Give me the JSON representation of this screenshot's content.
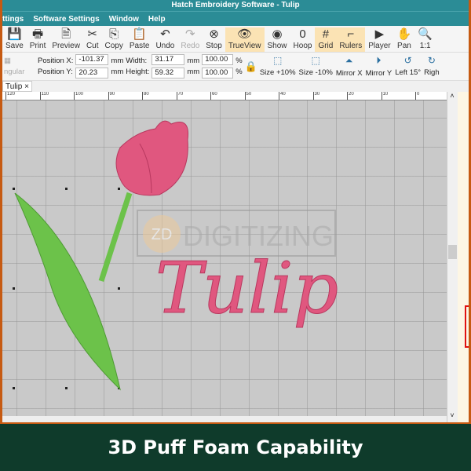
{
  "window": {
    "title": "Hatch Embroidery Software - Tulip"
  },
  "menu": [
    "ttings",
    "Software Settings",
    "Window",
    "Help"
  ],
  "toolbar": [
    {
      "label": "Save",
      "icon": "save-icon",
      "glyph": "💾"
    },
    {
      "label": "Print",
      "icon": "print-icon",
      "glyph": "🖶"
    },
    {
      "label": "Preview",
      "icon": "preview-icon",
      "glyph": "🗎"
    },
    {
      "label": "Cut",
      "icon": "cut-icon",
      "glyph": "✂"
    },
    {
      "label": "Copy",
      "icon": "copy-icon",
      "glyph": "⎘"
    },
    {
      "label": "Paste",
      "icon": "paste-icon",
      "glyph": "📋"
    },
    {
      "label": "Undo",
      "icon": "undo-icon",
      "glyph": "↶"
    },
    {
      "label": "Redo",
      "icon": "redo-icon",
      "glyph": "↷",
      "disabled": true
    },
    {
      "label": "Stop",
      "icon": "stop-icon",
      "glyph": "⊗"
    },
    {
      "label": "TrueView",
      "icon": "eye-icon",
      "glyph": "👁",
      "active": true
    },
    {
      "label": "Show",
      "icon": "show-icon",
      "glyph": "◉"
    },
    {
      "label": "Hoop",
      "icon": "hoop-icon",
      "glyph": "0"
    },
    {
      "label": "Grid",
      "icon": "grid-icon",
      "glyph": "#",
      "active": true
    },
    {
      "label": "Rulers",
      "icon": "rulers-icon",
      "glyph": "⌐",
      "active": true
    },
    {
      "label": "Player",
      "icon": "player-icon",
      "glyph": "▶"
    },
    {
      "label": "Pan",
      "icon": "hand-icon",
      "glyph": "✋"
    },
    {
      "label": "1:1",
      "icon": "zoom-icon",
      "glyph": "🔍"
    }
  ],
  "props": {
    "mode": "ngular",
    "pos_x_label": "Position X:",
    "pos_y_label": "Position Y:",
    "pos_x": "-101.37",
    "pos_y": "20.23",
    "width_label": "Width:",
    "height_label": "Height:",
    "width": "31.17",
    "height": "59.32",
    "unit": "mm",
    "pct_w": "100.00",
    "pct_h": "100.00",
    "pct": "%"
  },
  "transforms": [
    {
      "label": "Size +10%",
      "glyph": "⬚"
    },
    {
      "label": "Size -10%",
      "glyph": "⬚"
    },
    {
      "label": "Mirror X",
      "glyph": "⏶"
    },
    {
      "label": "Mirror Y",
      "glyph": "⏵"
    },
    {
      "label": "Left 15°",
      "glyph": "↺"
    },
    {
      "label": "Righ",
      "glyph": "↻"
    }
  ],
  "tab": {
    "label": "Tulip",
    "close": "×"
  },
  "ruler": [
    "120",
    "110",
    "100",
    "90",
    "80",
    "70",
    "60",
    "50",
    "40",
    "30",
    "20",
    "10",
    "0"
  ],
  "design": {
    "text": "Tulip",
    "color_pink": "#e0577f",
    "color_green": "#6cc24a"
  },
  "watermark": {
    "logo": "ZD",
    "text": "DIGITIZING"
  },
  "banner": {
    "text": "3D Puff Foam Capability"
  }
}
